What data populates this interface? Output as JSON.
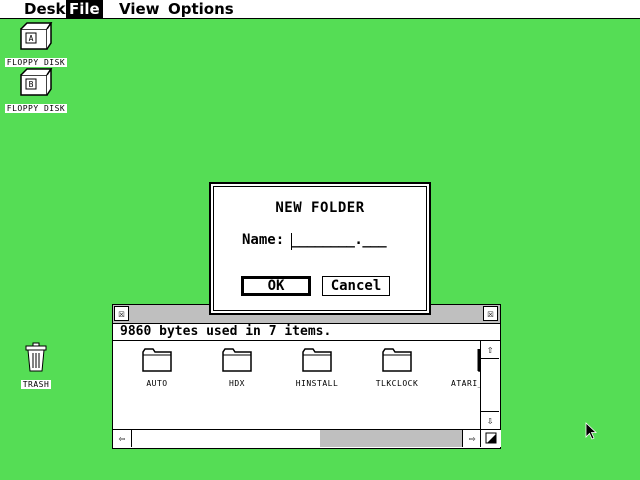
{
  "menubar": {
    "items": [
      {
        "label": "Desk",
        "active": false
      },
      {
        "label": "File",
        "active": true
      },
      {
        "label": "View",
        "active": false
      },
      {
        "label": "Options",
        "active": false
      }
    ]
  },
  "desktop": {
    "icons": [
      {
        "label": "FLOPPY DISK",
        "drive": "A",
        "icon": "floppy-drive-icon"
      },
      {
        "label": "FLOPPY DISK",
        "drive": "B",
        "icon": "floppy-drive-icon"
      },
      {
        "label": "TRASH",
        "icon": "trash-can-icon"
      }
    ]
  },
  "window": {
    "close_glyph": "☒",
    "fuller_glyph": "☒",
    "info": "9860 bytes used in 7 items.",
    "items": [
      {
        "label": "AUTO",
        "icon": "folder-icon"
      },
      {
        "label": "HDX",
        "icon": "folder-icon"
      },
      {
        "label": "HINSTALL",
        "icon": "folder-icon"
      },
      {
        "label": "TLKCLOCK",
        "icon": "folder-icon"
      },
      {
        "label": "ATARI_",
        "icon": "folder-icon"
      }
    ],
    "scroll": {
      "up": "⇧",
      "down": "⇩",
      "left": "⇦",
      "right": "⇨"
    }
  },
  "dialog": {
    "title": "NEW FOLDER",
    "name_label": "Name:",
    "name_value": "________.___",
    "ok_label": "OK",
    "cancel_label": "Cancel"
  },
  "colors": {
    "desktop": "#55DD55",
    "foreground": "#000000",
    "background": "#FFFFFF"
  }
}
